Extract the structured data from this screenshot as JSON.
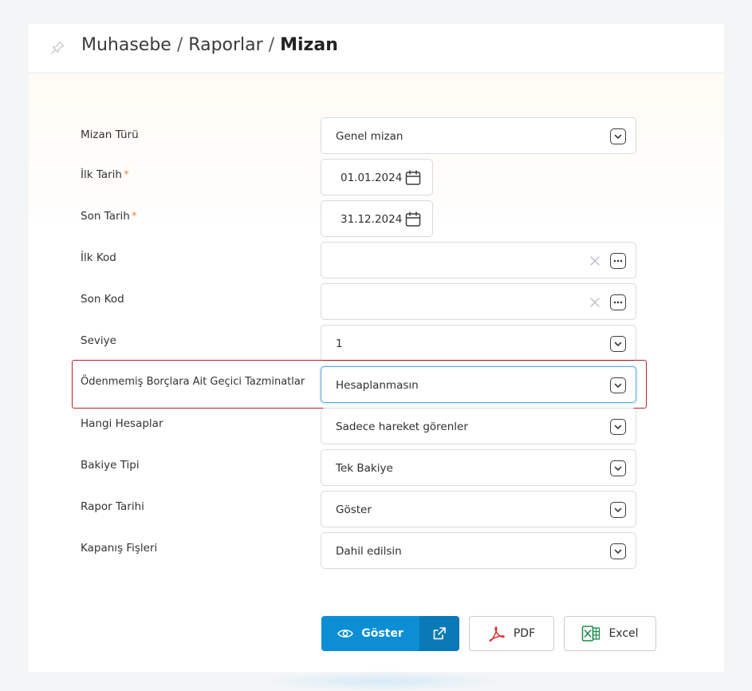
{
  "breadcrumb": {
    "part1": "Muhasebe",
    "part2": "Raporlar",
    "current": "Mizan",
    "separator": "/"
  },
  "fields": [
    {
      "label": "Mizan Türü",
      "value": "Genel mizan",
      "type": "select"
    },
    {
      "label": "İlk Tarih",
      "value": "01.01.2024",
      "type": "date",
      "required": "*"
    },
    {
      "label": "Son Tarih",
      "value": "31.12.2024",
      "type": "date",
      "required": "*"
    },
    {
      "label": "İlk Kod",
      "value": "",
      "type": "lookup"
    },
    {
      "label": "Son Kod",
      "value": "",
      "type": "lookup"
    },
    {
      "label": "Seviye",
      "value": "1",
      "type": "select"
    },
    {
      "label": "Ödenmemiş Borçlara Ait Geçici Tazminatlar",
      "value": "Hesaplanmasın",
      "type": "select"
    },
    {
      "label": "Hangi Hesaplar",
      "value": "Sadece hareket görenler",
      "type": "select"
    },
    {
      "label": "Bakiye Tipi",
      "value": "Tek Bakiye",
      "type": "select"
    },
    {
      "label": "Rapor Tarihi",
      "value": "Göster",
      "type": "select"
    },
    {
      "label": "Kapanış Fişleri",
      "value": "Dahil edilsin",
      "type": "select"
    }
  ],
  "buttons": {
    "show": "Göster",
    "pdf": "PDF",
    "excel": "Excel"
  },
  "colors": {
    "primary": "#0b8ed4",
    "primary_dark": "#0a79b6",
    "required": "#f08a3c",
    "highlight": "#b62228",
    "pdf_icon": "#e0302f",
    "excel_icon": "#1f8a4c"
  },
  "icons": {
    "pin": "pin-icon",
    "chevron": "chevron-down-icon",
    "calendar": "calendar-icon",
    "clear": "close-icon",
    "lookup": "more-icon",
    "eye": "eye-icon",
    "external": "external-link-icon",
    "pdf": "pdf-icon",
    "excel": "excel-icon"
  }
}
